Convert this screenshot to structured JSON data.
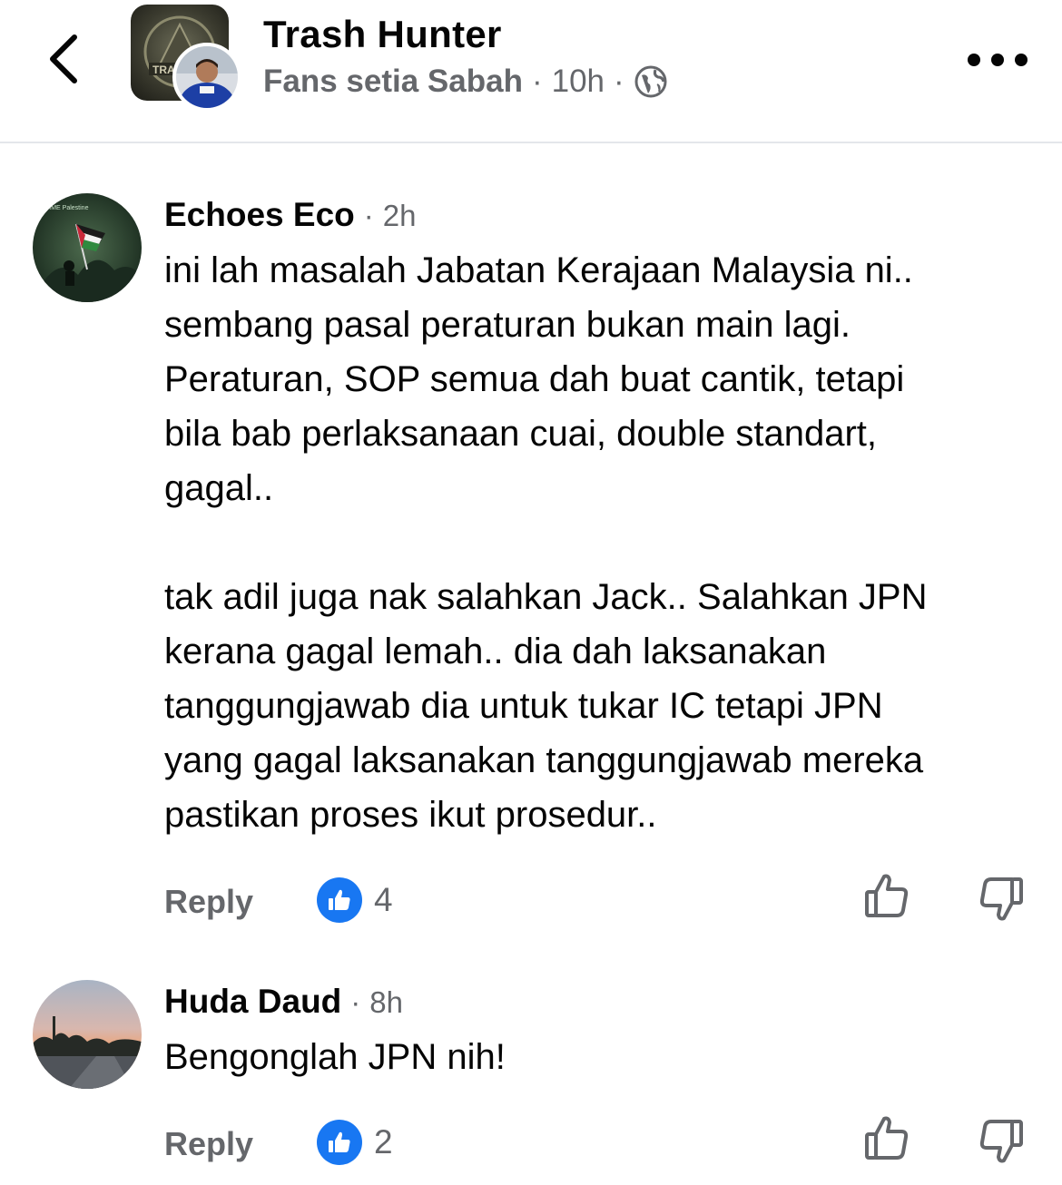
{
  "header": {
    "title": "Trash Hunter",
    "group_name": "Fans setia Sabah",
    "separator": "·",
    "time": "10h",
    "audience_icon": "globe-icon",
    "back_icon": "chevron-left-icon",
    "more_icon": "more-horizontal-icon"
  },
  "comments": [
    {
      "author": "Echoes Eco",
      "separator": "·",
      "time": "2h",
      "text": "ini lah masalah Jabatan Kerajaan Malaysia ni..\nsembang pasal peraturan bukan main lagi.\nPeraturan, SOP semua dah buat cantik, tetapi\nbila bab perlaksanaan cuai, double standart,\ngagal..\n\ntak adil juga nak salahkan Jack.. Salahkan JPN\nkerana gagal lemah.. dia dah laksanakan\ntanggungjawab dia untuk tukar IC tetapi JPN\nyang gagal laksanakan tanggungjawab mereka\npastikan proses ikut prosedur..",
      "reply_label": "Reply",
      "like_count": "4"
    },
    {
      "author": "Huda Daud",
      "separator": "·",
      "time": "8h",
      "text": "Bengonglah JPN nih!",
      "reply_label": "Reply",
      "like_count": "2"
    }
  ],
  "colors": {
    "text_primary": "#050505",
    "text_secondary": "#65676b",
    "like_blue": "#1877f2",
    "divider": "#e4e6eb"
  }
}
